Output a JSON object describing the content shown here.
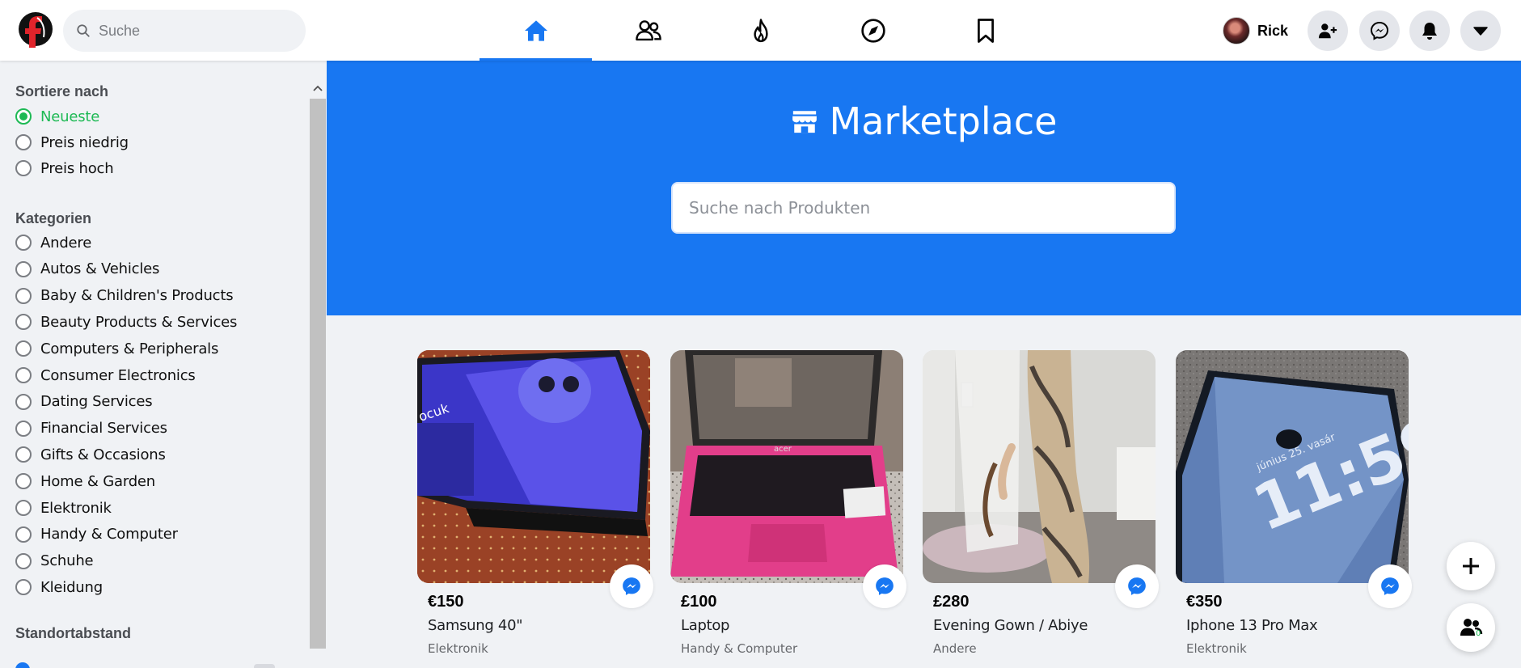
{
  "header": {
    "search_placeholder": "Suche",
    "nav": [
      {
        "name": "home",
        "active": true
      },
      {
        "name": "friends",
        "active": false
      },
      {
        "name": "trending",
        "active": false
      },
      {
        "name": "explore",
        "active": false
      },
      {
        "name": "saved",
        "active": false
      }
    ],
    "profile_name": "Rick",
    "accent": "#1877f2"
  },
  "sidebar": {
    "sort_title": "Sortiere nach",
    "sort_options": [
      {
        "label": "Neueste",
        "checked": true
      },
      {
        "label": "Preis niedrig",
        "checked": false
      },
      {
        "label": "Preis hoch",
        "checked": false
      }
    ],
    "categories_title": "Kategorien",
    "categories": [
      "Andere",
      "Autos & Vehicles",
      "Baby & Children's Products",
      "Beauty Products & Services",
      "Computers & Peripherals",
      "Consumer Electronics",
      "Dating Services",
      "Financial Services",
      "Gifts & Occasions",
      "Home & Garden",
      "Elektronik",
      "Handy & Computer",
      "Schuhe",
      "Kleidung"
    ],
    "distance_title": "Standortabstand",
    "selected_color": "#1db954"
  },
  "hero": {
    "title": "Marketplace",
    "search_placeholder": "Suche nach Produkten"
  },
  "products": [
    {
      "price": "€150",
      "title": "Samsung 40\"",
      "category": "Elektronik"
    },
    {
      "price": "£100",
      "title": "Laptop",
      "category": "Handy & Computer"
    },
    {
      "price": "£280",
      "title": "Evening Gown / Abiye",
      "category": "Andere"
    },
    {
      "price": "€350",
      "title": "Iphone 13 Pro Max",
      "category": "Elektronik"
    }
  ],
  "floating": {
    "people_count": "0"
  }
}
